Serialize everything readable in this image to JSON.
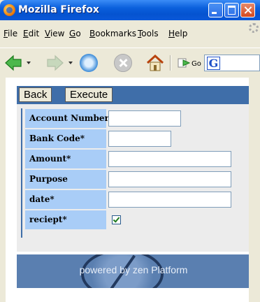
{
  "window": {
    "title": "Mozilla Firefox"
  },
  "menu": {
    "items": [
      {
        "label": "File",
        "ul": "F"
      },
      {
        "label": "Edit",
        "ul": "E"
      },
      {
        "label": "View",
        "ul": "V"
      },
      {
        "label": "Go",
        "ul": "G"
      },
      {
        "label": "Bookmarks",
        "ul": "B"
      },
      {
        "label": "Tools",
        "ul": "T"
      },
      {
        "label": "Help",
        "ul": "H"
      }
    ]
  },
  "nav": {
    "go_label": "Go",
    "search_logo": "G"
  },
  "toolbar": {
    "back_label": "Back",
    "execute_label": "Execute"
  },
  "form": {
    "fields": [
      {
        "label": "Account Number*",
        "value": "",
        "type": "text"
      },
      {
        "label": "Bank Code*",
        "value": "",
        "type": "text"
      },
      {
        "label": "Amount*",
        "value": "",
        "type": "text"
      },
      {
        "label": "Purpose",
        "value": "",
        "type": "text"
      },
      {
        "label": "date*",
        "value": "",
        "type": "text"
      },
      {
        "label": "reciept*",
        "checked": true,
        "type": "checkbox"
      }
    ]
  },
  "footer": {
    "text": "powered by zen Platform"
  }
}
